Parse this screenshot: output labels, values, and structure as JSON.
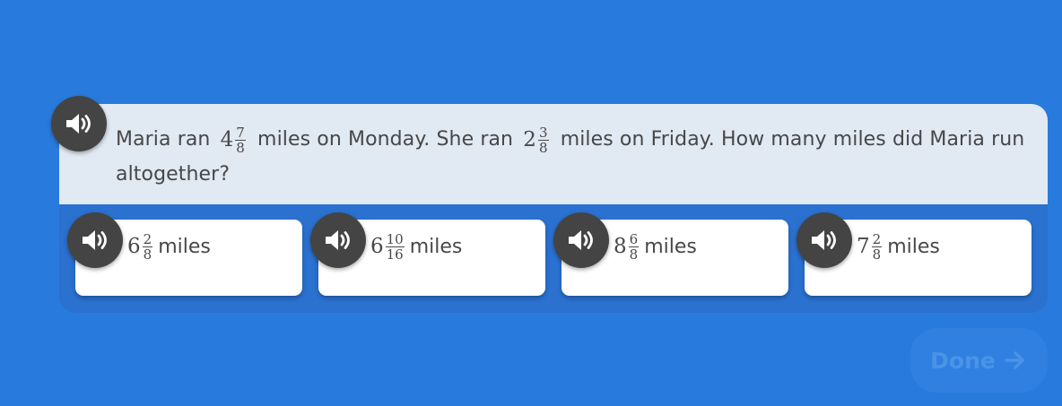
{
  "question": {
    "prefix": "Maria ran",
    "frac1": {
      "whole": "4",
      "num": "7",
      "den": "8"
    },
    "mid": "miles on Monday. She ran",
    "frac2": {
      "whole": "2",
      "num": "3",
      "den": "8"
    },
    "suffix": "miles on Friday. How many miles did Maria run altogether?"
  },
  "choices": [
    {
      "whole": "6",
      "num": "2",
      "den": "8",
      "unit": "miles"
    },
    {
      "whole": "6",
      "num": "10",
      "den": "16",
      "unit": "miles"
    },
    {
      "whole": "8",
      "num": "6",
      "den": "8",
      "unit": "miles"
    },
    {
      "whole": "7",
      "num": "2",
      "den": "8",
      "unit": "miles"
    }
  ],
  "done_button": {
    "label": "Done",
    "icon": "arrow-right-icon",
    "state": "disabled"
  },
  "audio_icon": "speaker-icon",
  "colors": {
    "background": "#287bdc",
    "question_bg": "#e1e9f3",
    "speaker": "#444444",
    "text": "#474747"
  }
}
